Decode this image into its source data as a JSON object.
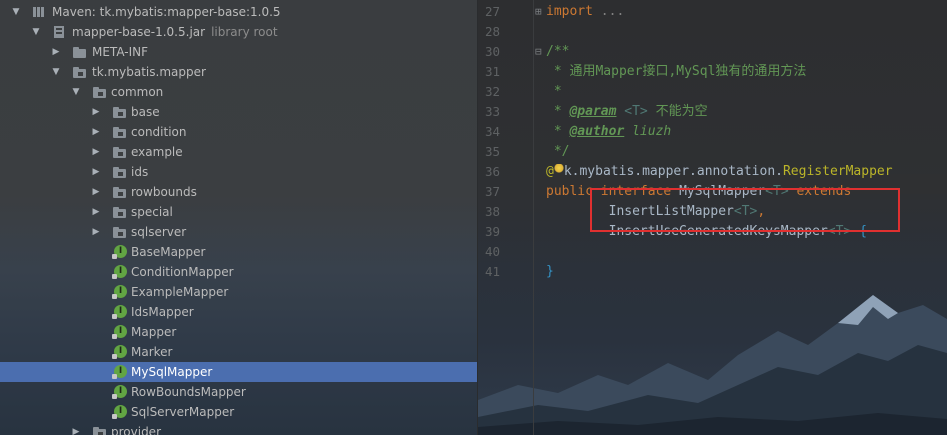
{
  "tree": {
    "rows": [
      {
        "label": "Maven: tk.mybatis:mapper-base:1.0.5",
        "sublabel": ""
      },
      {
        "label": "mapper-base-1.0.5.jar",
        "sublabel": "library root"
      },
      {
        "label": "META-INF"
      },
      {
        "label": "tk.mybatis.mapper"
      },
      {
        "label": "common"
      },
      {
        "label": "base"
      },
      {
        "label": "condition"
      },
      {
        "label": "example"
      },
      {
        "label": "ids"
      },
      {
        "label": "rowbounds"
      },
      {
        "label": "special"
      },
      {
        "label": "sqlserver"
      },
      {
        "label": "BaseMapper"
      },
      {
        "label": "ConditionMapper"
      },
      {
        "label": "ExampleMapper"
      },
      {
        "label": "IdsMapper"
      },
      {
        "label": "Mapper"
      },
      {
        "label": "Marker"
      },
      {
        "label": "MySqlMapper"
      },
      {
        "label": "RowBoundsMapper"
      },
      {
        "label": "SqlServerMapper"
      },
      {
        "label": "provider"
      }
    ],
    "selected": "MySqlMapper",
    "interface_icon_letter": "I"
  },
  "editor": {
    "line_numbers": [
      "27",
      "28",
      "30",
      "31",
      "32",
      "33",
      "34",
      "35",
      "36",
      "37",
      "38",
      "39",
      "40",
      "41"
    ],
    "import_text": "import",
    "import_fold": "...",
    "doc_open": "/**",
    "doc_line1": " * 通用Mapper接口,MySql独有的通用方法",
    "doc_star": " *",
    "doc_param_prefix": " * ",
    "param_tag": "@param",
    "param_type": "<T>",
    "param_desc": " 不能为空",
    "author_tag": "@author",
    "author_name": "liuzh",
    "doc_close": " */",
    "ann_at": "@",
    "ann_rest": "k.mybatis.mapper.annotation.",
    "ann_name": "RegisterMapper",
    "kw_public": "public",
    "kw_interface": "interface",
    "class_name": "MySqlMapper",
    "type_param": "<T>",
    "kw_extends": "extends",
    "ext1_name": "InsertListMapper",
    "ext1_generic": "<T>",
    "ext1_comma": ",",
    "ext2_name": "InsertUseGeneratedKeysMapper",
    "ext2_generic": "<T>",
    "open_brace": "{",
    "close_brace": "}"
  },
  "colors": {
    "selection": "#4b6eaf",
    "highlight_box": "#e03030",
    "keyword": "#cc7832",
    "comment": "#629755"
  }
}
